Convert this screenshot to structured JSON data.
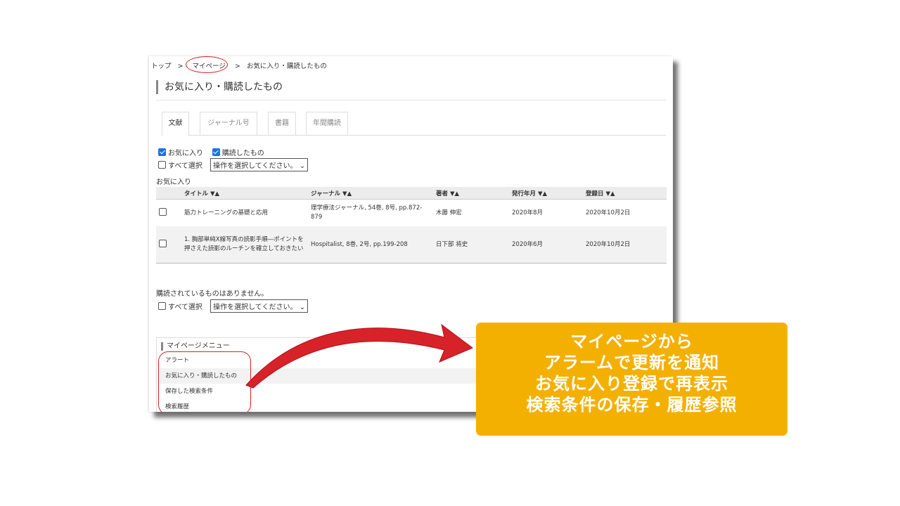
{
  "breadcrumb": {
    "top": "トップ",
    "sep": ">",
    "mypage": "マイページ",
    "current": "お気に入り・購読したもの"
  },
  "page_title": "お気に入り・購読したもの",
  "tabs": [
    {
      "label": "文献",
      "active": true
    },
    {
      "label": "ジャーナル号",
      "active": false
    },
    {
      "label": "書籍",
      "active": false
    },
    {
      "label": "年間購読",
      "active": false
    }
  ],
  "filters": {
    "favorites": "お気に入り",
    "subscribed": "購読したもの"
  },
  "select_all": "すべて選択",
  "action_select": "操作を選択してください。",
  "favorites_label": "お気に入り",
  "table": {
    "headers": [
      "タイトル ▼▲",
      "ジャーナル ▼▲",
      "著者 ▼▲",
      "発行年月 ▼▲",
      "登録日 ▼▲"
    ],
    "rows": [
      {
        "title": "筋力トレーニングの基礎と応用",
        "journal": "理学療法ジャーナル, 54巻, 8号, pp.872-879",
        "author": "木藤 伸宏",
        "published": "2020年8月",
        "registered": "2020年10月2日"
      },
      {
        "title": "1. 胸部単純X線写真の読影手順―ポイントを押さえた読影のルーチンを確立しておきたい",
        "journal": "Hospitalist, 8巻, 2号, pp.199-208",
        "author": "日下部 将史",
        "published": "2020年6月",
        "registered": "2020年10月2日"
      }
    ]
  },
  "no_subscriptions": "購読されているものはありません。",
  "mypage_menu": {
    "title": "マイページメニュー",
    "items": [
      "アラート",
      "お気に入り・購読したもの",
      "保存した検索条件",
      "検索履歴"
    ]
  },
  "callout": {
    "lines": [
      "マイページから",
      "アラームで更新を通知",
      "お気に入り登録で再表示",
      "検索条件の保存・履歴参照"
    ],
    "color": "#f4b000"
  },
  "colors": {
    "annotation_red": "#d8222a",
    "checkbox_blue": "#1a73e8"
  }
}
